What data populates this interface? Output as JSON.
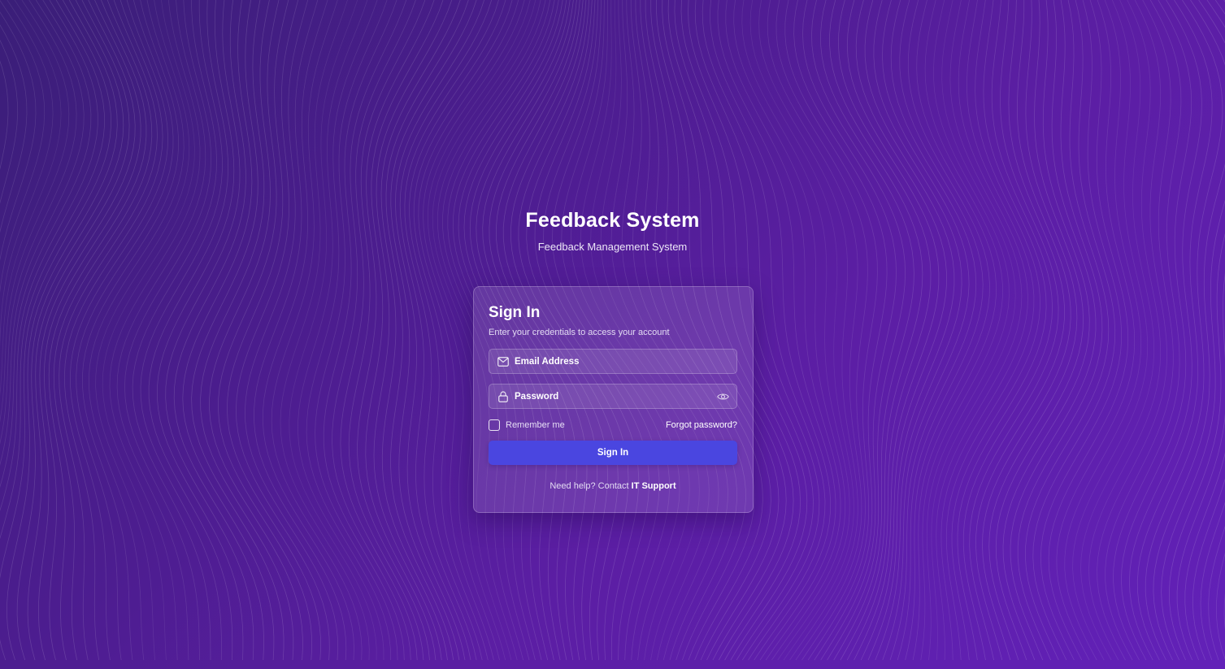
{
  "app": {
    "title": "Feedback System",
    "subtitle": "Feedback Management System"
  },
  "signin": {
    "heading": "Sign In",
    "description": "Enter your credentials to access your account",
    "email": {
      "placeholder": "Email Address",
      "value": "",
      "icon": "mail-icon"
    },
    "password": {
      "placeholder": "Password",
      "value": "",
      "icon": "lock-icon",
      "toggle_icon": "eye-icon"
    },
    "remember_label": "Remember me",
    "remember_checked": false,
    "forgot_label": "Forgot password?",
    "submit_label": "Sign In",
    "help_prefix": "Need help? Contact",
    "help_link": "IT Support"
  },
  "colors": {
    "background_start": "#3a1e78",
    "background_end": "#6221b8",
    "button": "#4a46e0"
  }
}
